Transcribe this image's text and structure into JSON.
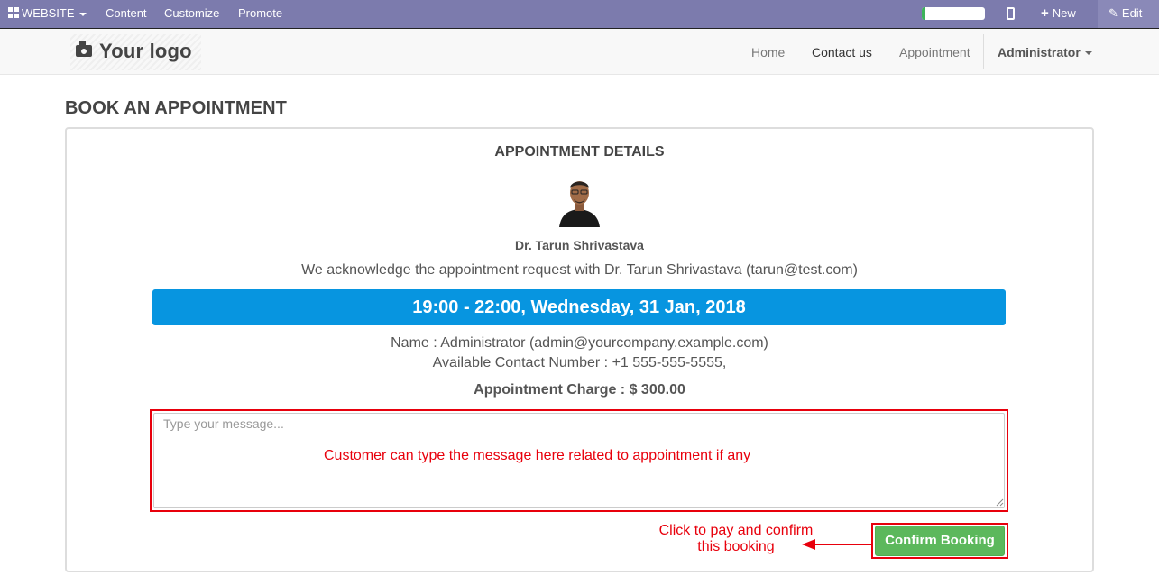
{
  "adminbar": {
    "website_label": "WEBSITE",
    "menu": [
      "Content",
      "Customize",
      "Promote"
    ],
    "progress_fraction": 0.05,
    "new_label": "New",
    "edit_label": "Edit"
  },
  "navbar": {
    "logo_text": "Your logo",
    "links": [
      "Home",
      "Contact us",
      "Appointment"
    ],
    "active_link": "Contact us",
    "user_label": "Administrator"
  },
  "page": {
    "title": "BOOK AN APPOINTMENT",
    "details_heading": "APPOINTMENT DETAILS",
    "doctor_name": "Dr. Tarun Shrivastava",
    "ack_text": "We acknowledge the appointment request with Dr. Tarun Shrivastava (tarun@test.com)",
    "time_slot": "19:00 - 22:00, Wednesday, 31 Jan, 2018",
    "name_line": "Name : Administrator (admin@yourcompany.example.com)",
    "contact_line": "Available Contact Number : +1 555-555-5555,",
    "charge_line": "Appointment Charge : $ 300.00",
    "message_placeholder": "Type your message...",
    "message_value": "",
    "confirm_label": "Confirm Booking"
  },
  "annotations": {
    "message_note": "Customer can type the message here related to appointment if any",
    "confirm_note": "Click to pay and confirm this booking",
    "color": "#e8000c"
  },
  "colors": {
    "adminbar": "#7c7bad",
    "banner": "#0795e0",
    "confirm": "#5cb85c"
  }
}
